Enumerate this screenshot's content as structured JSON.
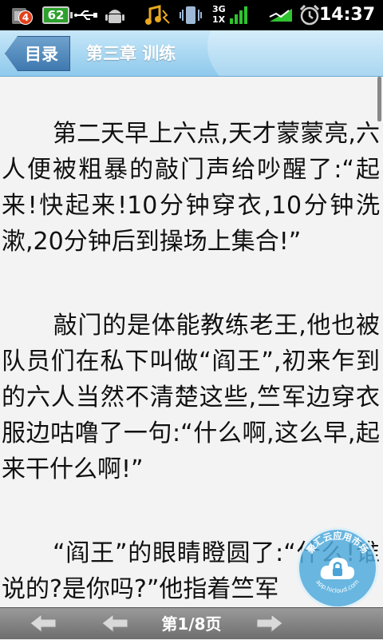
{
  "status_bar": {
    "notification_count": "4",
    "battery_level": "62",
    "network": "3G",
    "network_alt": "1X",
    "time": "14:37"
  },
  "header": {
    "back_label": "目录",
    "chapter_title": "第三章 训练"
  },
  "content": {
    "paragraphs": [
      "第二天早上六点,天才蒙蒙亮,六人便被粗暴的敲门声给吵醒了:“起来!快起来!10分钟穿衣,10分钟洗漱,20分钟后到操场上集合!”",
      "敲门的是体能教练老王,他也被队员们在私下叫做“阎王”,初来乍到的六人当然不清楚这些,竺军边穿衣服边咕噜了一句:“什么啊,这么早,起来干什么啊!”",
      "“阎王”的眼睛瞪圆了:“什么!谁说的?是你吗?”他指着竺军"
    ]
  },
  "watermark": {
    "text": "聚汇云应用市场",
    "url": "app.hicloud.com"
  },
  "footer": {
    "page_indicator": "第1/8页"
  },
  "colors": {
    "title_bar": "#8ec9ec",
    "back_button": "#3f79b0",
    "page_background": "#f3f3f3",
    "bottom_bar": "#7a7a7a"
  }
}
